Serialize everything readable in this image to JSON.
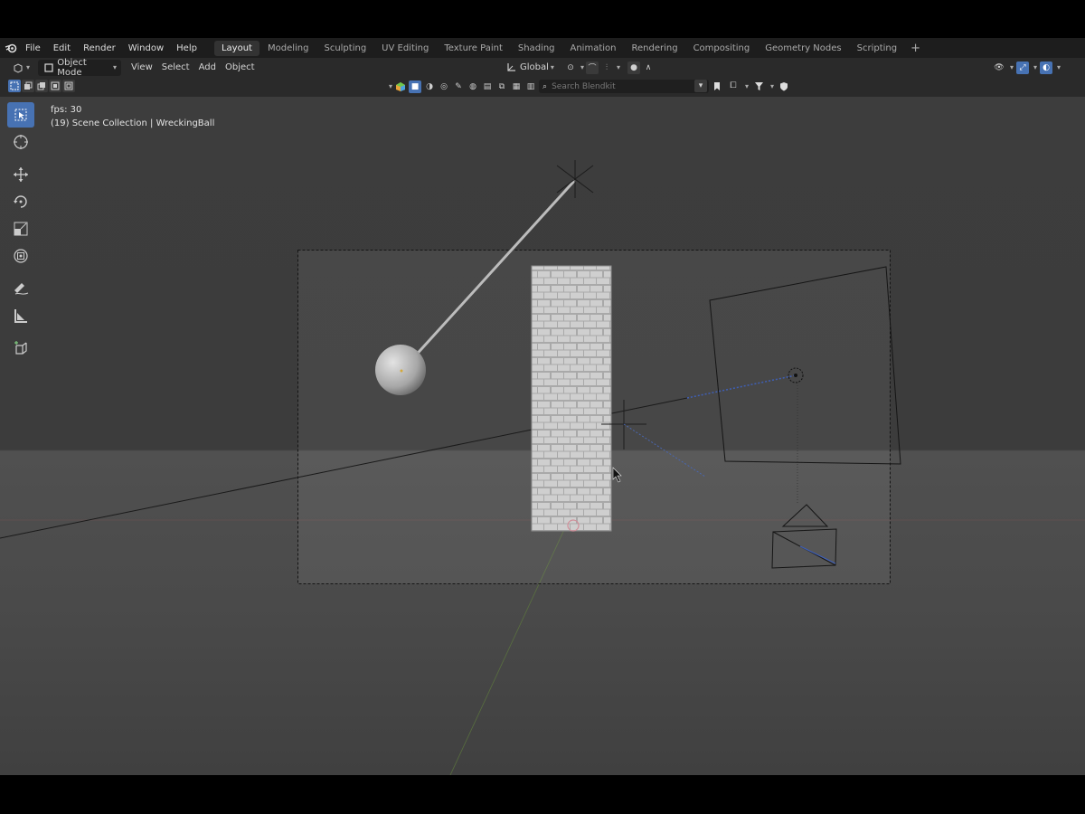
{
  "app": {
    "menus": [
      "File",
      "Edit",
      "Render",
      "Window",
      "Help"
    ],
    "workspaces": [
      "Layout",
      "Modeling",
      "Sculpting",
      "UV Editing",
      "Texture Paint",
      "Shading",
      "Animation",
      "Rendering",
      "Compositing",
      "Geometry Nodes",
      "Scripting"
    ],
    "active_workspace": "Layout",
    "add_workspace": "+"
  },
  "header": {
    "mode": "Object Mode",
    "view": "View",
    "select": "Select",
    "add": "Add",
    "object": "Object",
    "transform_orientation": "Global"
  },
  "toolbar2": {
    "search_placeholder": "Search Blendkit"
  },
  "viewport": {
    "fps": "fps: 30",
    "collection": "(19) Scene Collection | WreckingBall"
  },
  "tools": [
    {
      "name": "select-box-tool",
      "icon": "cursor-arrow-icon",
      "active": true
    },
    {
      "name": "cursor-tool",
      "icon": "3d-cursor-icon",
      "active": false
    },
    {
      "name": "move-tool",
      "icon": "move-arrows-icon",
      "active": false
    },
    {
      "name": "rotate-tool",
      "icon": "rotate-icon",
      "active": false
    },
    {
      "name": "scale-tool",
      "icon": "scale-icon",
      "active": false
    },
    {
      "name": "transform-tool",
      "icon": "transform-icon",
      "active": false
    },
    {
      "name": "annotate-tool",
      "icon": "pencil-icon",
      "active": false
    },
    {
      "name": "measure-tool",
      "icon": "ruler-icon",
      "active": false
    },
    {
      "name": "add-cube-tool",
      "icon": "add-cube-icon",
      "active": false
    }
  ],
  "colors": {
    "accent": "#4772b3",
    "topbar": "#1d1d1d",
    "header": "#2a2a2a"
  }
}
